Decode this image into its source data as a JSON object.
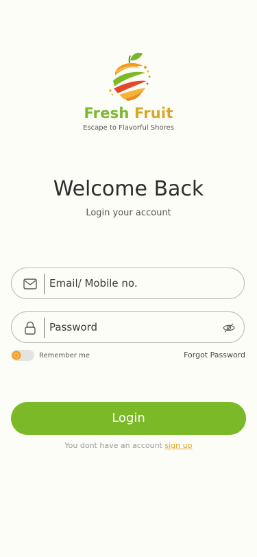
{
  "brand": {
    "name_part1": "Fresh",
    "name_part2": "Fruit",
    "tagline": "Escape to Flavorful Shores",
    "logo_icon": "fruit-logo",
    "green": "#7bb82d",
    "gold": "#d7a72a"
  },
  "welcome": {
    "title": "Welcome Back",
    "subtitle": "Login your account"
  },
  "form": {
    "email": {
      "icon": "mail-icon",
      "placeholder": "Email/ Mobile no.",
      "value": ""
    },
    "password": {
      "icon": "lock-icon",
      "placeholder": "Password",
      "value": "",
      "toggle_icon": "eye-off-icon"
    },
    "remember_label": "Remember me",
    "remember_checked": false,
    "forgot_label": "Forgot Password"
  },
  "actions": {
    "login_label": "Login",
    "login_color": "#7cb928"
  },
  "footer": {
    "prompt": "You dont have an account",
    "signup_label": "sign up",
    "link_color": "#e1a21d"
  }
}
